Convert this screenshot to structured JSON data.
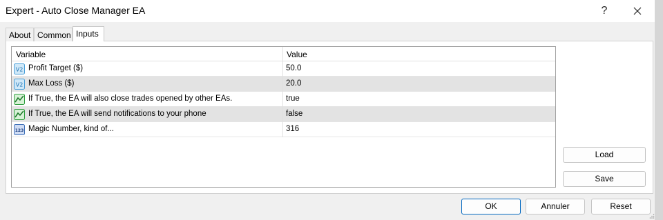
{
  "window": {
    "title": "Expert - Auto Close Manager EA",
    "help_glyph": "?",
    "close_icon": "close-icon"
  },
  "tabs": [
    {
      "label": "About",
      "active": false
    },
    {
      "label": "Common",
      "active": false
    },
    {
      "label": "Inputs",
      "active": true
    }
  ],
  "table": {
    "headers": {
      "variable": "Variable",
      "value": "Value"
    },
    "rows": [
      {
        "icon": "double-value-icon",
        "icon_text": "V2",
        "name": "Profit Target ($)",
        "value": "50.0",
        "shaded": false
      },
      {
        "icon": "double-value-icon",
        "icon_text": "V2",
        "name": "Max Loss ($)",
        "value": "20.0",
        "shaded": true
      },
      {
        "icon": "boolean-chart-icon",
        "icon_text": "",
        "name": "If True, the EA will also close trades opened by other EAs.",
        "value": "true",
        "shaded": false
      },
      {
        "icon": "boolean-chart-icon",
        "icon_text": "",
        "name": "If True, the EA will send notifications to your phone",
        "value": "false",
        "shaded": true
      },
      {
        "icon": "integer-value-icon",
        "icon_text": "123",
        "name": "Magic Number, kind of...",
        "value": "316",
        "shaded": false
      }
    ]
  },
  "side_buttons": {
    "load": "Load",
    "save": "Save"
  },
  "footer_buttons": {
    "ok": "OK",
    "cancel": "Annuler",
    "reset": "Reset"
  },
  "colors": {
    "accent": "#0067c0",
    "row_shade": "#e3e3e3",
    "icon_blue": "#4a9fd8",
    "icon_green": "#2e9e3e"
  }
}
